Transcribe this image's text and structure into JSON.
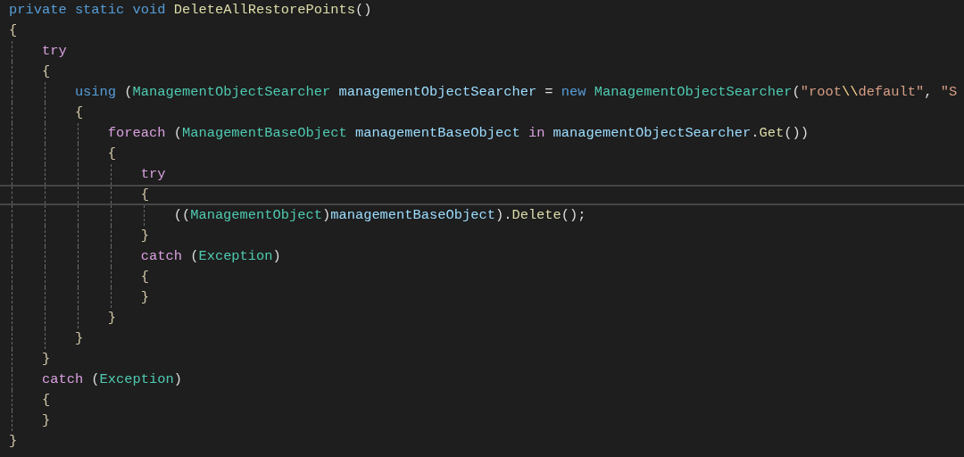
{
  "editor": {
    "lines": [
      {
        "current": false,
        "tokens": [
          {
            "kind": "keyword",
            "text": "private static void "
          },
          {
            "kind": "method",
            "text": "DeleteAllRestorePoints"
          },
          {
            "kind": "punct",
            "text": "()"
          }
        ]
      },
      {
        "current": false,
        "tokens": [
          {
            "kind": "brace",
            "text": "{"
          }
        ]
      },
      {
        "current": false,
        "tokens": [
          {
            "kind": "control",
            "text": "    try"
          }
        ]
      },
      {
        "current": false,
        "tokens": [
          {
            "kind": "brace",
            "text": "    {"
          }
        ]
      },
      {
        "current": false,
        "tokens": [
          {
            "kind": "keyword",
            "text": "        using "
          },
          {
            "kind": "punct",
            "text": "("
          },
          {
            "kind": "type",
            "text": "ManagementObjectSearcher "
          },
          {
            "kind": "variable",
            "text": "managementObjectSearcher "
          },
          {
            "kind": "punct",
            "text": "= "
          },
          {
            "kind": "keyword",
            "text": "new "
          },
          {
            "kind": "type",
            "text": "ManagementObjectSearcher"
          },
          {
            "kind": "punct",
            "text": "("
          },
          {
            "kind": "string",
            "text": "\"root"
          },
          {
            "kind": "escape",
            "text": "\\\\"
          },
          {
            "kind": "string",
            "text": "default\""
          },
          {
            "kind": "punct",
            "text": ", "
          },
          {
            "kind": "string",
            "text": "\"S"
          }
        ]
      },
      {
        "current": false,
        "tokens": [
          {
            "kind": "brace",
            "text": "        {"
          }
        ]
      },
      {
        "current": false,
        "tokens": [
          {
            "kind": "control",
            "text": "            foreach "
          },
          {
            "kind": "punct",
            "text": "("
          },
          {
            "kind": "type",
            "text": "ManagementBaseObject "
          },
          {
            "kind": "variable",
            "text": "managementBaseObject "
          },
          {
            "kind": "control",
            "text": "in "
          },
          {
            "kind": "variable",
            "text": "managementObjectSearcher"
          },
          {
            "kind": "punct",
            "text": "."
          },
          {
            "kind": "method",
            "text": "Get"
          },
          {
            "kind": "punct",
            "text": "())"
          }
        ]
      },
      {
        "current": false,
        "tokens": [
          {
            "kind": "brace",
            "text": "            {"
          }
        ]
      },
      {
        "current": false,
        "tokens": [
          {
            "kind": "control",
            "text": "                try"
          }
        ]
      },
      {
        "current": true,
        "tokens": [
          {
            "kind": "brace",
            "text": "                {"
          }
        ]
      },
      {
        "current": false,
        "tokens": [
          {
            "kind": "punct",
            "text": "                    (("
          },
          {
            "kind": "type",
            "text": "ManagementObject"
          },
          {
            "kind": "punct",
            "text": ")"
          },
          {
            "kind": "variable",
            "text": "managementBaseObject"
          },
          {
            "kind": "punct",
            "text": ")."
          },
          {
            "kind": "method",
            "text": "Delete"
          },
          {
            "kind": "punct",
            "text": "();"
          }
        ]
      },
      {
        "current": false,
        "tokens": [
          {
            "kind": "brace",
            "text": "                }"
          }
        ]
      },
      {
        "current": false,
        "tokens": [
          {
            "kind": "control",
            "text": "                catch "
          },
          {
            "kind": "punct",
            "text": "("
          },
          {
            "kind": "type",
            "text": "Exception"
          },
          {
            "kind": "punct",
            "text": ")"
          }
        ]
      },
      {
        "current": false,
        "tokens": [
          {
            "kind": "brace",
            "text": "                {"
          }
        ]
      },
      {
        "current": false,
        "tokens": [
          {
            "kind": "brace",
            "text": "                }"
          }
        ]
      },
      {
        "current": false,
        "tokens": [
          {
            "kind": "brace",
            "text": "            }"
          }
        ]
      },
      {
        "current": false,
        "tokens": [
          {
            "kind": "brace",
            "text": "        }"
          }
        ]
      },
      {
        "current": false,
        "tokens": [
          {
            "kind": "brace",
            "text": "    }"
          }
        ]
      },
      {
        "current": false,
        "tokens": [
          {
            "kind": "control",
            "text": "    catch "
          },
          {
            "kind": "punct",
            "text": "("
          },
          {
            "kind": "type",
            "text": "Exception"
          },
          {
            "kind": "punct",
            "text": ")"
          }
        ]
      },
      {
        "current": false,
        "tokens": [
          {
            "kind": "brace",
            "text": "    {"
          }
        ]
      },
      {
        "current": false,
        "tokens": [
          {
            "kind": "brace",
            "text": "    }"
          }
        ]
      },
      {
        "current": false,
        "tokens": [
          {
            "kind": "brace",
            "text": "}"
          }
        ]
      }
    ]
  }
}
